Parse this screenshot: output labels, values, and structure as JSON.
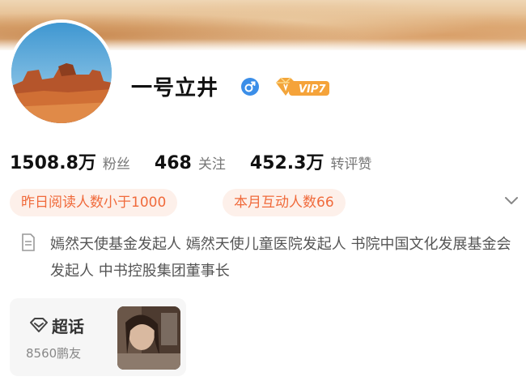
{
  "profile": {
    "name": "一号立井",
    "vip_label": "VIP7"
  },
  "stats": [
    {
      "value": "1508.8万",
      "label": "粉丝"
    },
    {
      "value": "468",
      "label": "关注"
    },
    {
      "value": "452.3万",
      "label": "转评赞"
    }
  ],
  "tags": [
    "昨日阅读人数小于1000",
    "本月互动人数66"
  ],
  "bio": "嫣然天使基金发起人 嫣然天使儿童医院发起人 书院中国文化发展基金会发起人 中书控股集团董事长",
  "supertopic": {
    "title": "超话",
    "count": "8560鹏友"
  },
  "colors": {
    "accent": "#f06a3b",
    "tag_bg": "#fdf0ea",
    "verified_blue": "#3b8ee8",
    "vip_gold": "#f3a53a"
  },
  "icons": [
    "male-icon",
    "vip-badge-icon",
    "chevron-down-icon",
    "document-icon",
    "supertopic-icon"
  ]
}
